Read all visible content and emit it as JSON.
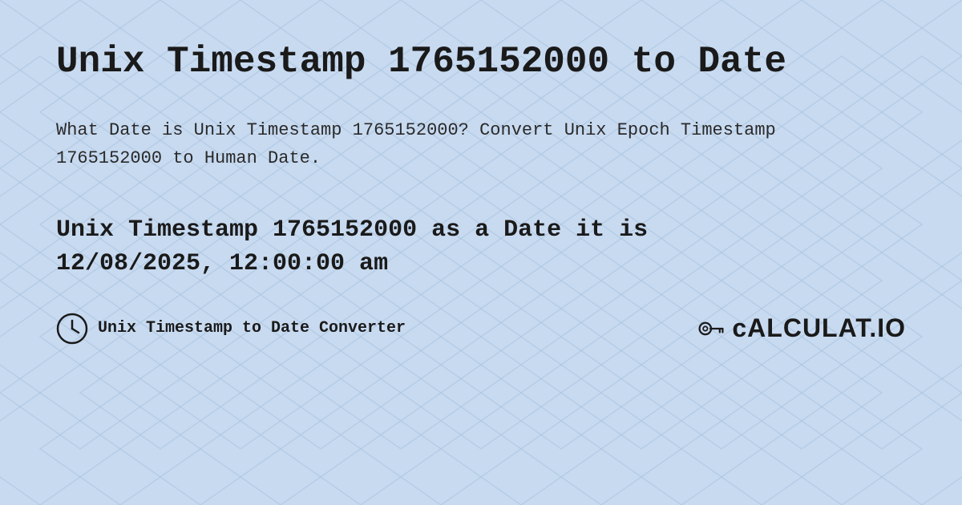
{
  "page": {
    "title": "Unix Timestamp 1765152000 to Date",
    "description": "What Date is Unix Timestamp 1765152000? Convert Unix Epoch Timestamp 1765152000 to Human Date.",
    "result_line1": "Unix Timestamp 1765152000 as a Date it is",
    "result_line2": "12/08/2025, 12:00:00 am",
    "footer_label": "Unix Timestamp to Date Converter",
    "logo_text": "cALCULAT.IO",
    "background_color": "#c8daf0",
    "accent_color": "#1a1a1a"
  }
}
